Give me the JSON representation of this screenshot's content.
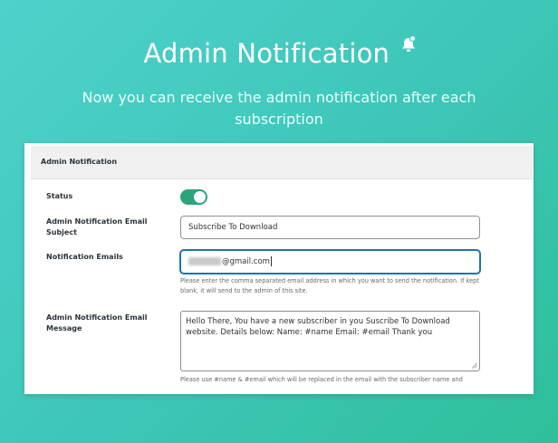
{
  "hero": {
    "title": "Admin Notification",
    "subtitle": "Now you can receive the admin notification after each subscription",
    "title_icon": "bell-icon"
  },
  "panel": {
    "header": "Admin Notification",
    "status": {
      "label": "Status",
      "enabled": true
    },
    "email_subject": {
      "label": "Admin Notification Email Subject",
      "value": "Subscribe To Download"
    },
    "notification_emails": {
      "label": "Notification Emails",
      "value_suffix": "@gmail.com",
      "help": "Please enter the comma separated email address in which you want to send the notification. If kept blank, it will send to the admin of this site."
    },
    "email_message": {
      "label": "Admin Notification Email Message",
      "value": "Hello There, You have a new subscriber in you Suscribe To Download website. Details below: Name: #name Email: #email Thank you",
      "help": "Please use #name & #email which will be replaced in the email with the subscriber name and"
    }
  },
  "colors": {
    "background_start": "#4fd1cb",
    "background_end": "#2fbf9a",
    "toggle_on": "#2aa57a",
    "focus_border": "#2271b1"
  }
}
